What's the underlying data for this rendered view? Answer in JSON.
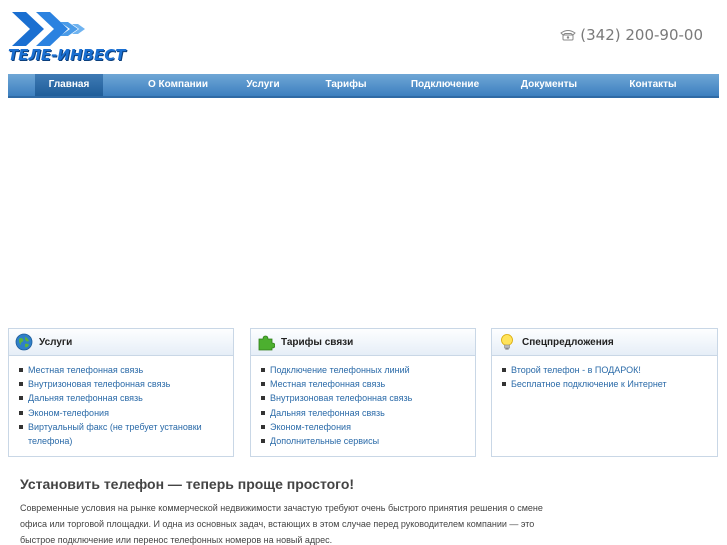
{
  "brand": {
    "logo_text": "ТЕЛЕ-ИНВЕСТ",
    "phone": "(342) 200-90-00",
    "colors": {
      "logo_blue": "#1a6fd1",
      "nav_blue": "#3d7fbf",
      "link_blue": "#2a6aa8"
    }
  },
  "nav": {
    "items": [
      {
        "label": "Главная",
        "active": true
      },
      {
        "label": "О Компании"
      },
      {
        "label": "Услуги"
      },
      {
        "label": "Тарифы"
      },
      {
        "label": "Подключение"
      },
      {
        "label": "Документы"
      },
      {
        "label": "Контакты"
      }
    ]
  },
  "panels": {
    "services": {
      "title": "Услуги",
      "icon": "globe-icon",
      "items": [
        "Местная телефонная связь",
        "Внутризоновая телефонная связь",
        "Дальняя телефонная связь",
        "Эконом-телефония",
        "Виртуальный факс (не требует установки телефона)"
      ]
    },
    "tariffs": {
      "title": "Тарифы связи",
      "icon": "puzzle-icon",
      "items": [
        "Подключение телефонных линий",
        "Местная телефонная связь",
        "Внутризоновая телефонная связь",
        "Дальняя телефонная связь",
        "Эконом-телефония",
        "Дополнительные сервисы"
      ]
    },
    "offers": {
      "title": "Спецпредложения",
      "icon": "lightbulb-icon",
      "items": [
        "Второй телефон - в ПОДАРОК!",
        "Бесплатное подключение к Интернет"
      ]
    }
  },
  "content": {
    "headline": "Установить телефон — теперь проще простого!",
    "paragraph": "Современные условия на рынке коммерческой недвижимости зачастую требуют очень быстрого принятия решения о смене офиса или торговой площадки. И одна из основных задач, встающих в этом случае перед руководителем компании — это быстрое подключение или перенос телефонных номеров на новый адрес."
  }
}
